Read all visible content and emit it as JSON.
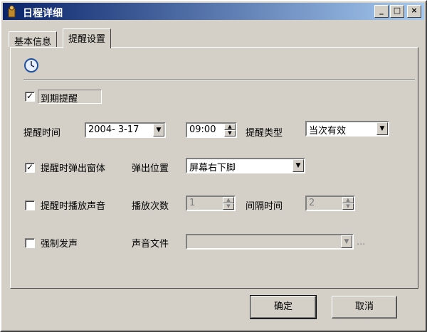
{
  "window": {
    "title": "日程详细",
    "icons": {
      "app": "app-icon",
      "minimize": "minimize-icon",
      "maximize": "maximize-icon",
      "close": "close-icon"
    }
  },
  "tabs": [
    {
      "label": "基本信息",
      "active": false
    },
    {
      "label": "提醒设置",
      "active": true
    }
  ],
  "reminder": {
    "header_icon": "clock-icon",
    "due_reminder": {
      "label": "到期提醒",
      "checked": true
    },
    "time_label": "提醒时间",
    "date_value": "2004- 3-17",
    "time_value": "09:00",
    "type_label": "提醒类型",
    "type_value": "当次有效",
    "popup": {
      "label": "提醒时弹出窗体",
      "checked": true
    },
    "popup_position_label": "弹出位置",
    "popup_position_value": "屏幕右下脚",
    "sound": {
      "label": "提醒时播放声音",
      "checked": false
    },
    "play_count_label": "播放次数",
    "play_count_value": "1",
    "interval_label": "间隔时间",
    "interval_value": "2",
    "force": {
      "label": "强制发声",
      "checked": false
    },
    "sound_file_label": "声音文件",
    "sound_file_value": "",
    "browse_label": "..."
  },
  "buttons": {
    "ok": "确定",
    "cancel": "取消"
  },
  "glyphs": {
    "check": "✓",
    "down": "▼",
    "up": "▲",
    "minimize": "_",
    "maximize": "□",
    "close": "×"
  },
  "colors": {
    "title_start": "#0a246a",
    "title_end": "#a6caf0",
    "face": "#d4d0c8"
  }
}
